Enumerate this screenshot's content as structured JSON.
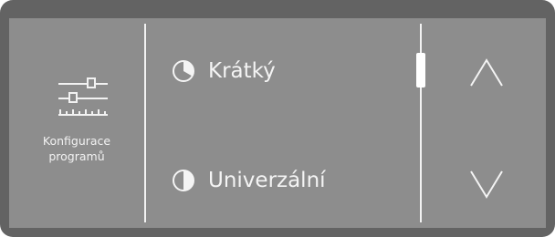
{
  "config": {
    "label": "Konfigurace\nprogramů",
    "icon": "sliders-icon"
  },
  "programs": [
    {
      "label": "Krátký",
      "icon": "clock-pie-icon"
    },
    {
      "label": "Univerzální",
      "icon": "clock-pie-half-icon"
    }
  ],
  "navigation": {
    "up_icon": "chevron-up-icon",
    "down_icon": "chevron-down-icon"
  },
  "scroll": {
    "position_fraction": 0.0
  },
  "colors": {
    "bezel": "#636363",
    "screen": "#8d8d8d",
    "foreground": "#f2f2f2"
  }
}
